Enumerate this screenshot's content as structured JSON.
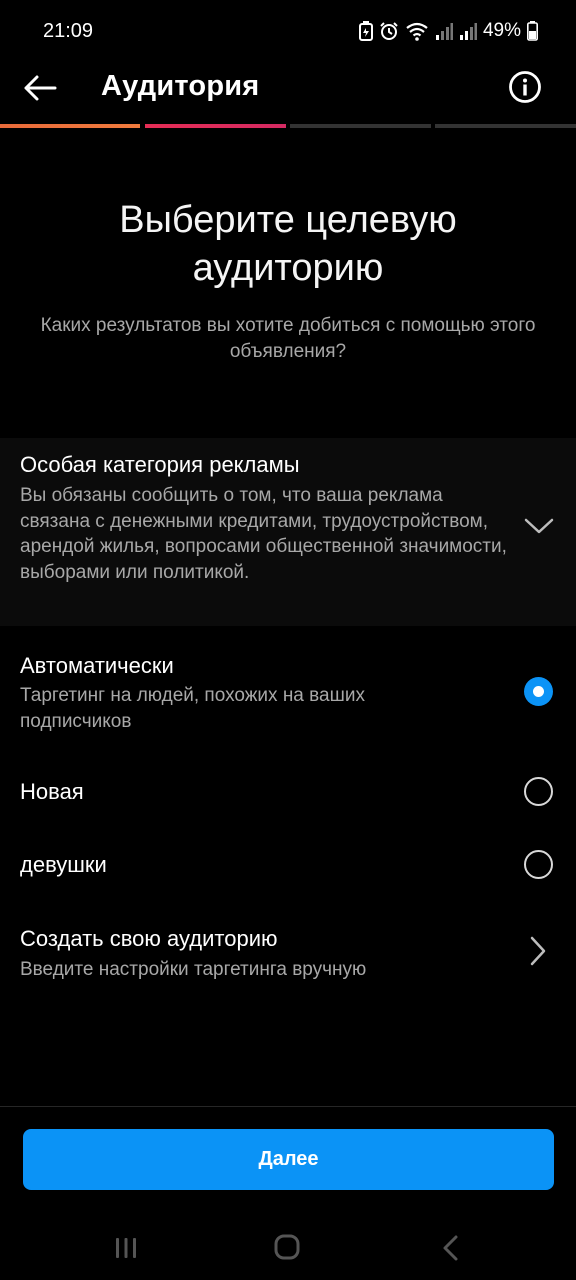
{
  "status_bar": {
    "time": "21:09",
    "battery": "49%",
    "icons": [
      "battery-saver-icon",
      "alarm-icon",
      "wifi-icon",
      "signal-icon",
      "signal-icon",
      "battery-icon"
    ]
  },
  "header": {
    "title": "Аудитория",
    "back_icon": "arrow-left-icon",
    "info_icon": "info-circle-icon"
  },
  "progress": {
    "steps": 4,
    "completed": 2,
    "colors": [
      "#f07b3d",
      "#e52d55",
      "#333333",
      "#333333"
    ]
  },
  "intro": {
    "headline": "Выберите целевую аудиторию",
    "subheading": "Каких результатов вы хотите добиться с помощью этого объявления?"
  },
  "special_category": {
    "title": "Особая категория рекламы",
    "description": "Вы обязаны сообщить о том, что ваша реклама связана с денежными кредитами, трудоустройством, арендой жилья, вопросами общественной значимости, выборами или политикой.",
    "icon": "chevron-down-icon"
  },
  "options": [
    {
      "title": "Автоматически",
      "description": "Таргетинг на людей, похожих на ваших подписчиков",
      "selected": true
    },
    {
      "title": "Новая",
      "selected": false
    },
    {
      "title": "девушки",
      "selected": false
    }
  ],
  "create_audience": {
    "title": "Создать свою аудиторию",
    "description": "Введите настройки таргетинга вручную",
    "icon": "chevron-right-icon"
  },
  "footer": {
    "next_label": "Далее",
    "accent_color": "#0b93f6"
  },
  "nav_bar": {
    "icons": [
      "recent-apps-icon",
      "home-icon",
      "back-icon"
    ]
  }
}
